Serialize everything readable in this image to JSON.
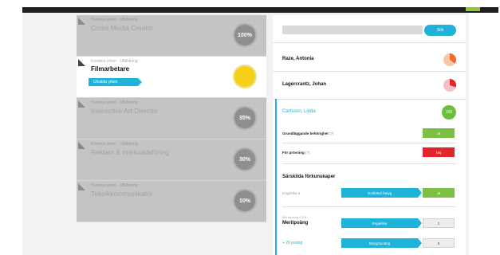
{
  "colors": {
    "accent": "#1fb3d9",
    "green": "#7bc043",
    "red": "#e2252b",
    "yellow": "#f7d117",
    "orange": "#f26a2e"
  },
  "left_list": {
    "cards": [
      {
        "category": "Kreativa yrken · Utbildning",
        "name": "Cross Media Creator",
        "percent": "100%",
        "active": false
      },
      {
        "category": "Kreativa yrken · Utbildning",
        "name": "Filmarbetare",
        "percent": "",
        "active": true,
        "tag": "Utvalda yrken"
      },
      {
        "category": "Kreativa yrken · Utbildning",
        "name": "Interactive Art Director",
        "percent": "35%",
        "active": false
      },
      {
        "category": "Kreativa yrken · Utbildning",
        "name": "Reklam & marknadsföring",
        "percent": "30%",
        "active": false
      },
      {
        "category": "Kreativa yrken · Utbildning",
        "name": "Teknikkommunikatör",
        "percent": "10%",
        "active": false
      }
    ]
  },
  "right_panel": {
    "search_button": "Sök",
    "people": [
      {
        "name": "Raze, Antonia"
      },
      {
        "name": "Lagercrantz, Johan"
      }
    ],
    "selected": {
      "name": "Carlsson, Linda",
      "badge": "100",
      "rows": [
        {
          "label": "Grundläggande behörighet",
          "q": "(?)",
          "value": "Ja"
        },
        {
          "label": "För prövning",
          "q": "(?)",
          "value": "Nej"
        }
      ]
    },
    "special": {
      "title": "Särskilda förkunskaper",
      "label": "Engelska 6",
      "bar": "Godkänd betyg",
      "tab": "Ja"
    },
    "extra": {
      "small": "Meritpoäng 0-2.5",
      "label": "Meritpoäng",
      "bar1": "Engelska",
      "count1": "2",
      "link": "+ 20 poäng",
      "bar2": "Betygspoäng",
      "count2": "8"
    }
  }
}
